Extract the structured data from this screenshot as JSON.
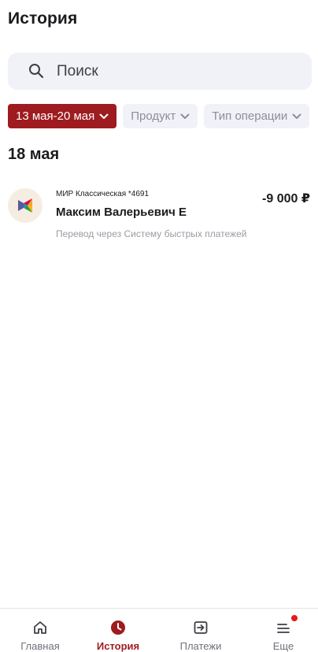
{
  "header": {
    "title": "История"
  },
  "search": {
    "placeholder": "Поиск",
    "icon": "search-icon"
  },
  "filters": [
    {
      "label": "13 мая-20 мая",
      "active": true
    },
    {
      "label": "Продукт",
      "active": false
    },
    {
      "label": "Тип операции",
      "active": false
    }
  ],
  "groups": [
    {
      "date": "18 мая",
      "transactions": [
        {
          "card": "МИР Классическая *4691",
          "name": "Максим Валерьевич Е",
          "amount": "-9 000 ₽",
          "description": "Перевод через Систему быстрых платежей",
          "logo": "sbp-logo"
        }
      ]
    }
  ],
  "nav": {
    "items": [
      {
        "label": "Главная",
        "icon": "home-icon",
        "active": false
      },
      {
        "label": "История",
        "icon": "clock-icon",
        "active": true
      },
      {
        "label": "Платежи",
        "icon": "payment-arrow-icon",
        "active": false
      },
      {
        "label": "Еще",
        "icon": "menu-icon",
        "active": false,
        "badge": true
      }
    ]
  },
  "colors": {
    "accent": "#9e1b1f",
    "chip_bg": "#f1f2f7",
    "badge": "#e31b1b"
  }
}
